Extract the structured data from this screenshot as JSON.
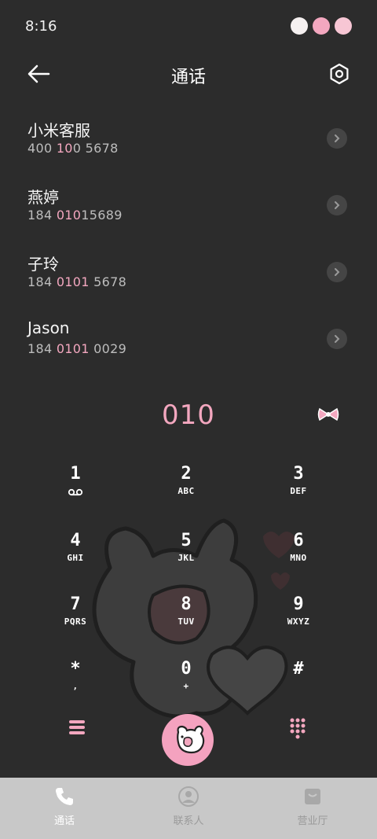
{
  "status": {
    "time": "8:16"
  },
  "header": {
    "title": "通话"
  },
  "contacts": [
    {
      "name": "小米客服",
      "num_pre": "400 ",
      "num_hl": "10",
      "num_post": "0 5678"
    },
    {
      "name": "燕婷",
      "num_pre": "184 ",
      "num_hl": "010",
      "num_post": "15689"
    },
    {
      "name": "子玲",
      "num_pre": "184 ",
      "num_hl": "0101",
      "num_post": " 5678"
    },
    {
      "name": "Jason",
      "num_pre": "184 ",
      "num_hl": "0101",
      "num_post": " 0029"
    }
  ],
  "dialer": {
    "entered": "010",
    "keys": [
      {
        "digit": "1",
        "letters": ""
      },
      {
        "digit": "2",
        "letters": "ABC"
      },
      {
        "digit": "3",
        "letters": "DEF"
      },
      {
        "digit": "4",
        "letters": "GHI"
      },
      {
        "digit": "5",
        "letters": "JKL"
      },
      {
        "digit": "6",
        "letters": "MNO"
      },
      {
        "digit": "7",
        "letters": "PQRS"
      },
      {
        "digit": "8",
        "letters": "TUV"
      },
      {
        "digit": "9",
        "letters": "WXYZ"
      },
      {
        "digit": "*",
        "letters": ","
      },
      {
        "digit": "0",
        "letters": "+"
      },
      {
        "digit": "#",
        "letters": ""
      }
    ]
  },
  "tabs": [
    {
      "label": "通话",
      "icon": "phone-icon"
    },
    {
      "label": "联系人",
      "icon": "contacts-icon"
    },
    {
      "label": "营业厅",
      "icon": "store-icon"
    }
  ],
  "colors": {
    "accent": "#f3a7bf",
    "background": "#2c2c2c",
    "tabbar": "#c8c8c8"
  }
}
